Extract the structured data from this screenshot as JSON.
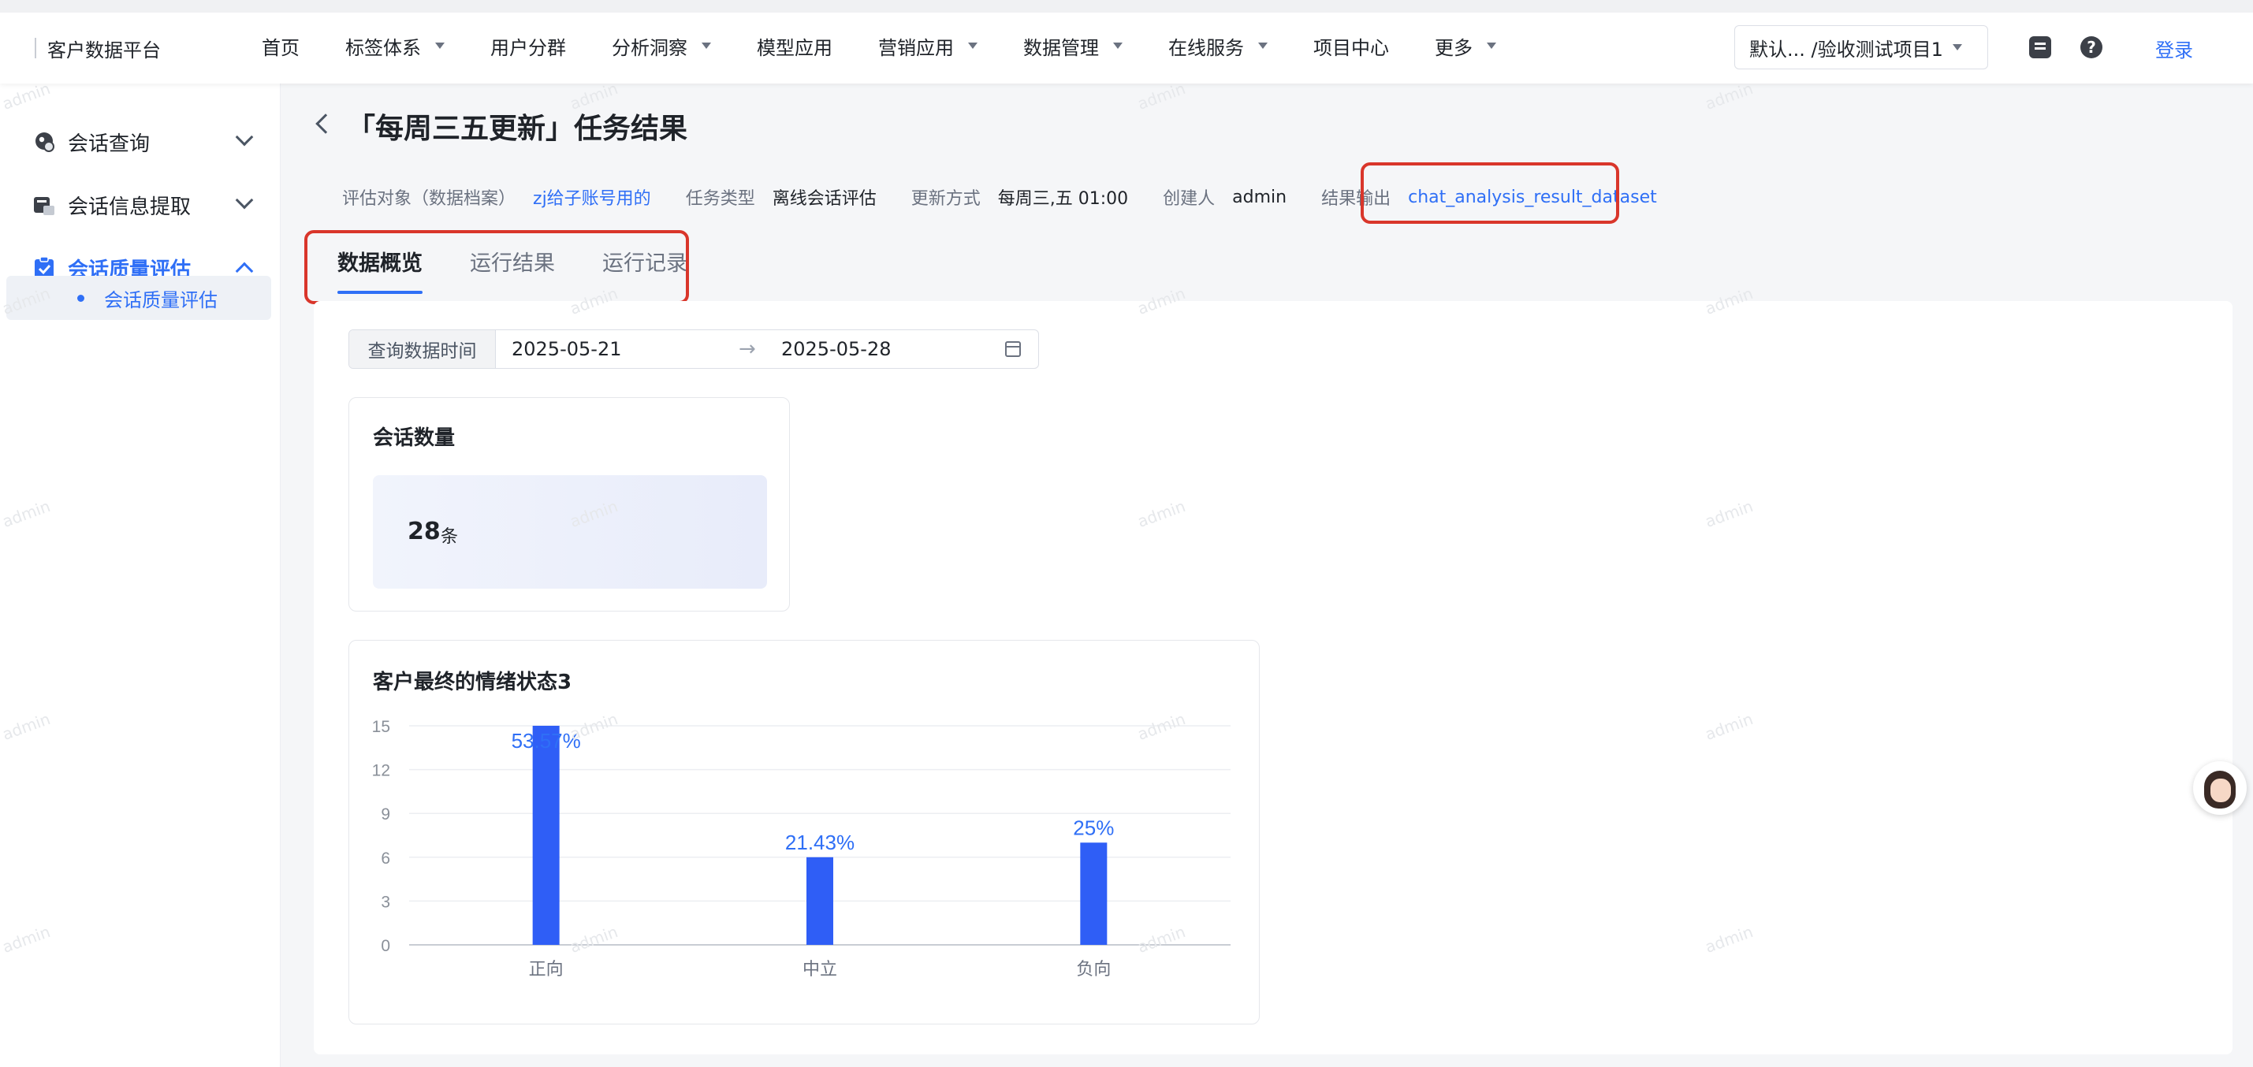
{
  "app": {
    "brand": "客户数据平台"
  },
  "topnav": {
    "items": [
      {
        "label": "首页",
        "dropdown": false
      },
      {
        "label": "标签体系",
        "dropdown": true
      },
      {
        "label": "用户分群",
        "dropdown": false
      },
      {
        "label": "分析洞察",
        "dropdown": true
      },
      {
        "label": "模型应用",
        "dropdown": false
      },
      {
        "label": "营销应用",
        "dropdown": true
      },
      {
        "label": "数据管理",
        "dropdown": true
      },
      {
        "label": "在线服务",
        "dropdown": true
      },
      {
        "label": "项目中心",
        "dropdown": false
      },
      {
        "label": "更多",
        "dropdown": true
      }
    ],
    "project_select": "默认...   /验收测试项目1",
    "login": "登录"
  },
  "sidebar": {
    "groups": [
      {
        "label": "会话查询",
        "icon": "chat-query-icon",
        "expanded": false
      },
      {
        "label": "会话信息提取",
        "icon": "info-extract-icon",
        "expanded": false
      },
      {
        "label": "会话质量评估",
        "icon": "quality-check-icon",
        "expanded": true
      }
    ],
    "sub_item": "会话质量评估"
  },
  "header": {
    "title": "「每周三五更新」任务结果",
    "meta": {
      "target_key": "评估对象（数据档案）",
      "target_value": "zj给子账号用的",
      "task_type_key": "任务类型",
      "task_type_value": "离线会话评估",
      "update_key": "更新方式",
      "update_value": "每周三,五 01:00",
      "creator_key": "创建人",
      "creator_value": "admin",
      "output_key": "结果输出",
      "output_value": "chat_analysis_result_dataset"
    }
  },
  "tabs": [
    {
      "label": "数据概览",
      "active": true
    },
    {
      "label": "运行结果",
      "active": false
    },
    {
      "label": "运行记录",
      "active": false
    }
  ],
  "filter": {
    "label": "查询数据时间",
    "start": "2025-05-21",
    "arrow": "→",
    "end": "2025-05-28"
  },
  "session_card": {
    "title": "会话数量",
    "value": "28",
    "unit": "条"
  },
  "emotion_card": {
    "title": "客户最终的情绪状态3"
  },
  "chart_data": {
    "type": "bar",
    "title": "客户最终的情绪状态3",
    "categories": [
      "正向",
      "中立",
      "负向"
    ],
    "values": [
      15,
      6,
      7
    ],
    "data_labels": [
      "53.57%",
      "21.43%",
      "25%"
    ],
    "ylim": [
      0,
      15
    ],
    "yticks": [
      0,
      3,
      6,
      9,
      12,
      15
    ],
    "grid": true,
    "bar_color": "#2f5ef6",
    "label_color": "#2f6ff6"
  },
  "colors": {
    "accent": "#2f6ff6",
    "highlight_box": "#d9362b"
  },
  "watermark": "admin"
}
